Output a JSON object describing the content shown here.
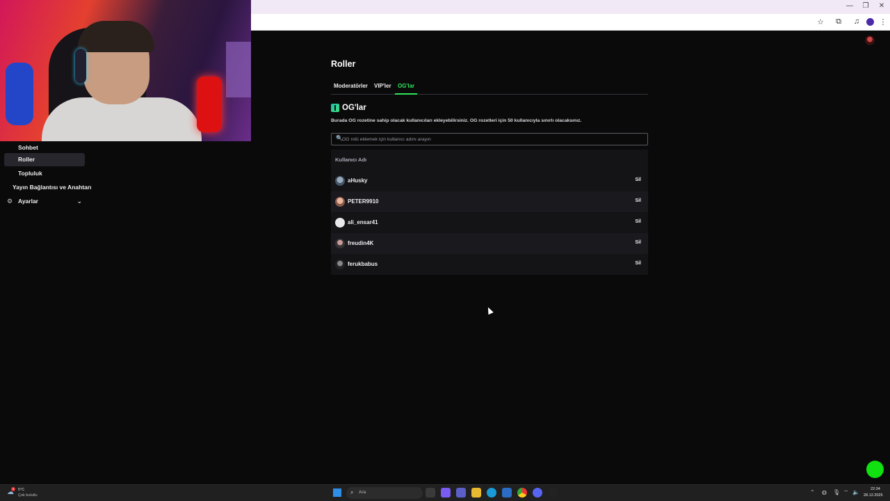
{
  "window": {
    "minimize_icon": "—",
    "maximize_icon": "❐",
    "close_icon": "✕"
  },
  "addressbar": {
    "bookmark_icon": "☆",
    "extensions_icon": "⧉",
    "media_icon": "♫",
    "profile_initial": "",
    "menu_icon": "⋮"
  },
  "sidebar": {
    "items": [
      {
        "label": "Sohbet",
        "active": false
      },
      {
        "label": "Roller",
        "active": true
      },
      {
        "label": "Topluluk",
        "active": false
      },
      {
        "label": "Yayın Bağlantısı ve Anahtarı",
        "active": false
      },
      {
        "label": "Ayarlar",
        "active": false,
        "icon": "gear-icon",
        "chevron": "chevron-down-icon"
      }
    ],
    "gear_glyph": "⚙",
    "chevron_glyph": "⌄"
  },
  "page": {
    "title": "Roller",
    "tabs": [
      {
        "label": "Moderatörler"
      },
      {
        "label": "VIP'ler"
      },
      {
        "label": "OG'lar",
        "active": true
      }
    ],
    "section_title": "OG'lar",
    "section_desc": "Burada OG rozetine sahip olacak kullanıcıları ekleyebilirsiniz. OG rozetleri için 50 kullanıcıyla sınırlı olacaksınız.",
    "search": {
      "placeholder": "OG rolü eklemek için kullanıcı adını arayın",
      "value": "",
      "icon": "🔍"
    },
    "table": {
      "header": "Kullanıcı Adı",
      "rows": [
        {
          "username": "aHusky",
          "action": "Sil"
        },
        {
          "username": "PETER9910",
          "action": "Sil"
        },
        {
          "username": "ali_ensar41",
          "action": "Sil"
        },
        {
          "username": "freudin4K",
          "action": "Sil"
        },
        {
          "username": "ferukbabus",
          "action": "Sil"
        }
      ]
    }
  },
  "taskbar": {
    "weather_temp": "5°C",
    "weather_desc": "Çok bulutlu",
    "weather_badge": "3",
    "search_label": "Ara",
    "time": "22:34",
    "date": "28.12.2025"
  },
  "colors": {
    "accent": "#2ee65b",
    "background": "#0a0a0b",
    "panel": "#141417",
    "status_dot": "#11e011"
  }
}
